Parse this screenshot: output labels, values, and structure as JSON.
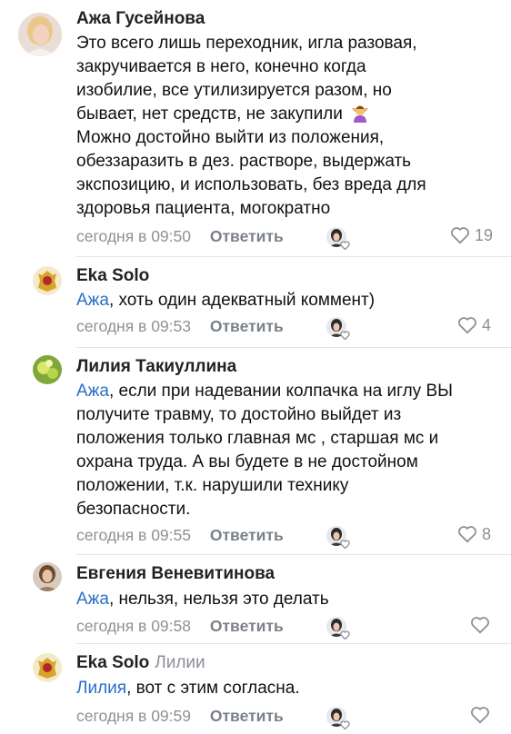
{
  "comments": [
    {
      "author": "Ажа Гусейнова",
      "lines": [
        "Это всего лишь переходник, игла разовая,",
        "закручивается в него, конечно когда",
        "изобилие, все утилизируется разом, но",
        "бывает, нет средств, не закупили",
        "Можно достойно выйти из положения,",
        "обеззаразить в дез. растворе, выдержать",
        "экспозицию, и использовать, без вреда для",
        "здоровья пациента, могократно"
      ],
      "time": "сегодня в 09:50",
      "reply_label": "Ответить",
      "likes": "19"
    },
    {
      "author": "Eka Solo",
      "mention": "Ажа",
      "text": ", хоть один адекватный коммент)",
      "time": "сегодня в 09:53",
      "reply_label": "Ответить",
      "likes": "4"
    },
    {
      "author": "Лилия Такиуллина",
      "mention": "Ажа",
      "first_line_rest": ", если при надевании колпачка на иглу ВЫ",
      "lines": [
        "получите травму, то достойно выйдет из",
        "положения только главная мс , старшая мс и",
        "охрана труда. А вы будете в не достойном",
        "положении, т.к. нарушили технику",
        "безопасности."
      ],
      "time": "сегодня в 09:55",
      "reply_label": "Ответить",
      "likes": "8"
    },
    {
      "author": "Евгения Веневитинова",
      "mention": "Ажа",
      "text": ", нельзя, нельзя это делать",
      "time": "сегодня в 09:58",
      "reply_label": "Ответить",
      "likes": ""
    },
    {
      "author": "Eka Solo",
      "reply_to": "Лилии",
      "mention": "Лилия",
      "text": ", вот с этим согласна.",
      "time": "сегодня в 09:59",
      "reply_label": "Ответить",
      "likes": ""
    }
  ],
  "colors": {
    "mention": "#2a6fc9",
    "meta": "#8d9097",
    "divider": "#e3e4e8"
  }
}
